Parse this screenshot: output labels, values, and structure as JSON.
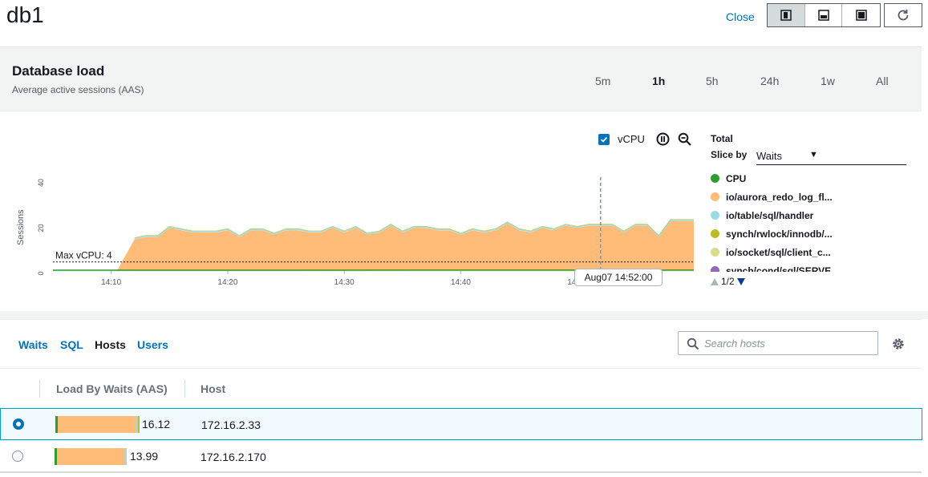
{
  "header": {
    "title": "db1",
    "close_label": "Close",
    "layout_buttons": [
      "layout-left-icon",
      "layout-bottom-icon",
      "layout-full-icon"
    ],
    "refresh_icon": "refresh-icon"
  },
  "load": {
    "title": "Database load",
    "subtitle": "Average active sessions (AAS)",
    "ranges": [
      {
        "label": "5m",
        "active": false
      },
      {
        "label": "1h",
        "active": true
      },
      {
        "label": "5h",
        "active": false
      },
      {
        "label": "24h",
        "active": false
      },
      {
        "label": "1w",
        "active": false
      },
      {
        "label": "All",
        "active": false
      }
    ],
    "vcpu_label": "vCPU",
    "vcpu_checked": true,
    "max_vcpu_label": "Max vCPU: 4",
    "tooltip": "Aug07 14:52:00"
  },
  "legend": {
    "total_label": "Total",
    "slice_label": "Slice by",
    "slice_value": "Waits",
    "items": [
      {
        "label": "CPU",
        "color": "#2ca02c"
      },
      {
        "label": "io/aurora_redo_log_fl...",
        "color": "#ffbb78"
      },
      {
        "label": "io/table/sql/handler",
        "color": "#9edae5"
      },
      {
        "label": "synch/rwlock/innodb/...",
        "color": "#bcbd22"
      },
      {
        "label": "io/socket/sql/client_c...",
        "color": "#dbdb8d"
      },
      {
        "label": "synch/cond/sql/SERVE...",
        "color": "#9467bd"
      }
    ],
    "pager": "1/2"
  },
  "chart_data": {
    "type": "area",
    "ylabel": "Sessions",
    "ylim": [
      0,
      40
    ],
    "yticks": [
      "0",
      "20",
      "40"
    ],
    "x_ticks": [
      "14:10",
      "14:20",
      "14:30",
      "14:40",
      "14:50"
    ],
    "x_start_min": 5,
    "x_end_min": 60,
    "vcpu_line": 4,
    "marker_min": 52,
    "series": [
      {
        "name": "io/aurora_redo_log_fl...",
        "color": "#ffbb78",
        "points": [
          [
            5,
            0
          ],
          [
            10.5,
            0
          ],
          [
            12,
            14
          ],
          [
            13,
            15
          ],
          [
            14,
            15
          ],
          [
            15,
            19
          ],
          [
            16,
            18
          ],
          [
            17,
            17
          ],
          [
            18,
            17
          ],
          [
            19,
            17
          ],
          [
            20,
            18
          ],
          [
            21,
            15
          ],
          [
            22,
            18
          ],
          [
            23,
            18
          ],
          [
            24,
            16
          ],
          [
            25,
            18
          ],
          [
            26,
            18
          ],
          [
            27,
            17
          ],
          [
            28,
            17
          ],
          [
            29,
            19
          ],
          [
            30,
            17
          ],
          [
            31,
            19
          ],
          [
            32,
            16
          ],
          [
            33,
            17
          ],
          [
            34,
            20
          ],
          [
            35,
            17
          ],
          [
            36,
            19
          ],
          [
            37,
            19
          ],
          [
            38,
            18
          ],
          [
            39,
            18
          ],
          [
            40,
            16
          ],
          [
            41,
            18
          ],
          [
            42,
            17
          ],
          [
            43,
            18
          ],
          [
            44,
            21
          ],
          [
            45,
            18
          ],
          [
            46,
            17
          ],
          [
            47,
            19
          ],
          [
            48,
            18
          ],
          [
            49,
            20
          ],
          [
            50,
            19
          ],
          [
            51,
            20
          ],
          [
            52,
            20
          ],
          [
            53,
            20
          ],
          [
            54,
            17
          ],
          [
            55,
            20
          ],
          [
            56,
            20
          ],
          [
            57,
            15
          ],
          [
            58,
            22
          ],
          [
            59,
            22
          ],
          [
            60,
            22
          ]
        ]
      },
      {
        "name": "CPU",
        "color": "#2ca02c",
        "points": [
          [
            5,
            0
          ],
          [
            60,
            0.4
          ]
        ]
      }
    ]
  },
  "bottom": {
    "tabs": [
      {
        "label": "Waits",
        "active": false
      },
      {
        "label": "SQL",
        "active": false
      },
      {
        "label": "Hosts",
        "active": true
      },
      {
        "label": "Users",
        "active": false
      }
    ],
    "search_placeholder": "Search hosts",
    "columns": [
      "Load By Waits (AAS)",
      "Host"
    ],
    "rows": [
      {
        "value": "16.12",
        "load": 16.12,
        "host": "172.16.2.33",
        "selected": true
      },
      {
        "value": "13.99",
        "load": 13.99,
        "host": "172.16.2.170",
        "selected": false
      }
    ]
  }
}
